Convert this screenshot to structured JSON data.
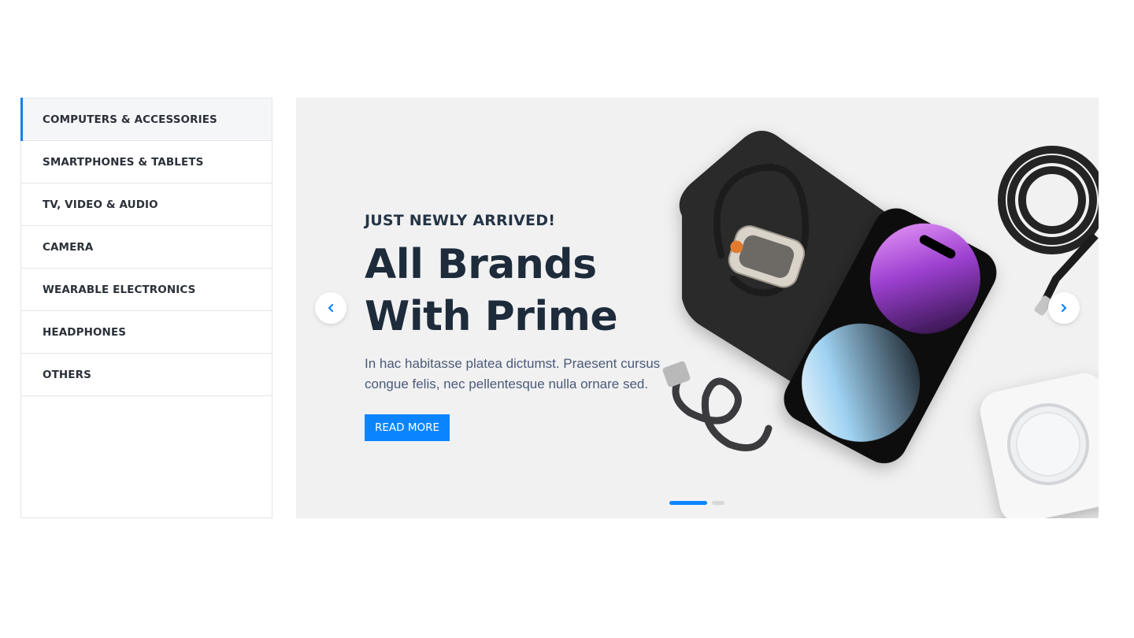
{
  "sidebar": {
    "items": [
      {
        "label": "COMPUTERS & ACCESSORIES",
        "active": true
      },
      {
        "label": "SMARTPHONES & TABLETS",
        "active": false
      },
      {
        "label": "TV, VIDEO & AUDIO",
        "active": false
      },
      {
        "label": "CAMERA",
        "active": false
      },
      {
        "label": "WEARABLE ELECTRONICS",
        "active": false
      },
      {
        "label": "HEADPHONES",
        "active": false
      },
      {
        "label": "OTHERS",
        "active": false
      }
    ]
  },
  "hero": {
    "eyebrow": "JUST NEWLY ARRIVED!",
    "headline_line1": "All Brands",
    "headline_line2": "With Prime",
    "description": "In hac habitasse platea dictumst. Praesent cursus congue felis, nec pellentesque nulla ornare sed.",
    "cta_label": "READ MORE",
    "prev_icon": "chevron-left-icon",
    "next_icon": "chevron-right-icon",
    "slide_count": 2,
    "active_slide": 1
  },
  "colors": {
    "accent": "#0a85ff",
    "heading": "#1d2b3b",
    "body_text": "#4a5a78",
    "slide_bg": "#f1f1f2"
  }
}
